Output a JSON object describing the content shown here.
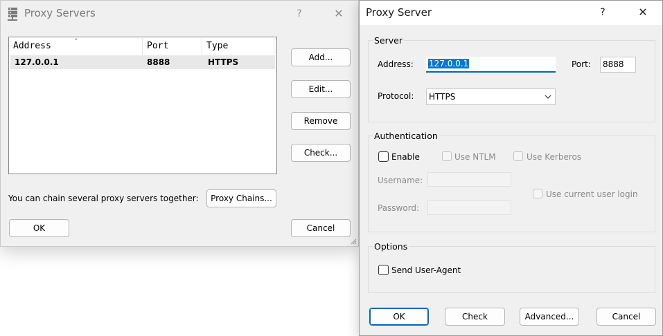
{
  "proxy_servers": {
    "title": "Proxy Servers",
    "help": "?",
    "close": "✕",
    "columns": [
      "Address",
      "Port",
      "Type"
    ],
    "sort_indicator": "ˆ",
    "rows": [
      {
        "address": "127.0.0.1",
        "port": "8888",
        "type": "HTTPS"
      }
    ],
    "buttons": {
      "add": "Add...",
      "edit": "Edit...",
      "remove": "Remove",
      "check": "Check..."
    },
    "chain_text": "You can chain several proxy servers together:",
    "proxy_chains": "Proxy Chains...",
    "ok": "OK",
    "cancel": "Cancel"
  },
  "proxy_server": {
    "title": "Proxy Server",
    "help": "?",
    "close": "✕",
    "server_group": "Server",
    "address_label": "Address:",
    "address_value": "127.0.0.1",
    "port_label": "Port:",
    "port_value": "8888",
    "protocol_label": "Protocol:",
    "protocol_value": "HTTPS",
    "auth_group": "Authentication",
    "enable": "Enable",
    "use_ntlm": "Use NTLM",
    "use_kerberos": "Use Kerberos",
    "username_label": "Username:",
    "password_label": "Password:",
    "use_current_login": "Use current user login",
    "options_group": "Options",
    "send_user_agent": "Send User-Agent",
    "ok": "OK",
    "check": "Check",
    "advanced": "Advanced...",
    "cancel": "Cancel"
  },
  "colors": {
    "selection": "#0078d7",
    "default_button_border": "#0067c0",
    "dialog_bg": "#f0f0f0"
  }
}
